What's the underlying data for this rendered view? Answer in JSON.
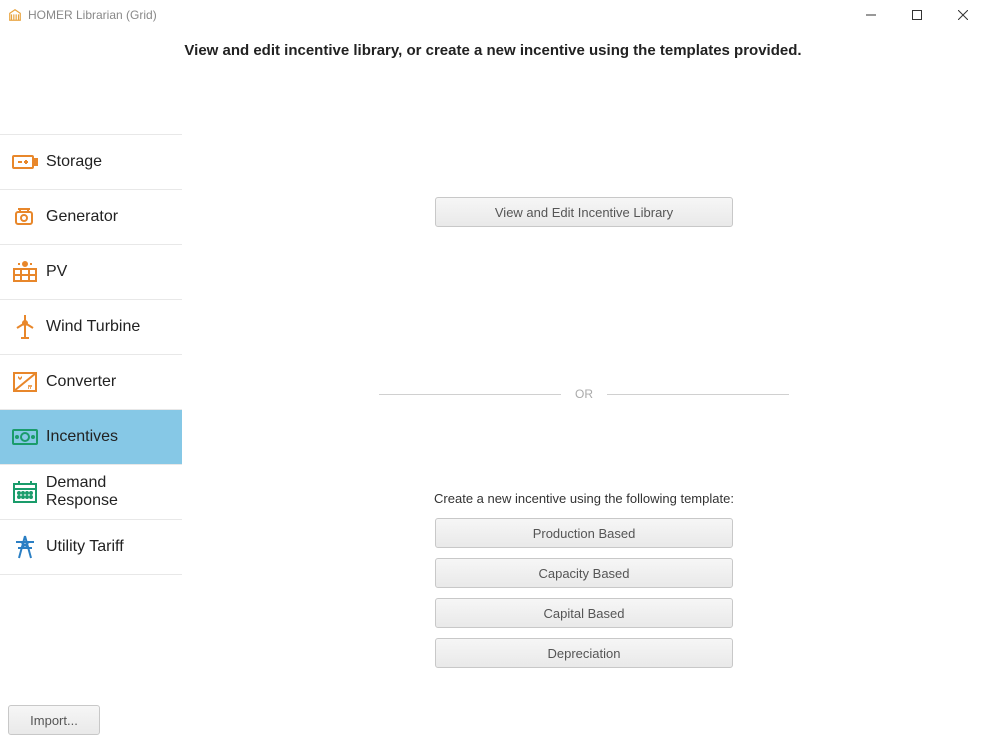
{
  "window": {
    "title": "HOMER Librarian (Grid)"
  },
  "header": {
    "description": "View and edit incentive library, or create a new incentive using the templates provided."
  },
  "sidebar": {
    "items": [
      {
        "label": "Storage"
      },
      {
        "label": "Generator"
      },
      {
        "label": "PV"
      },
      {
        "label": "Wind Turbine"
      },
      {
        "label": "Converter"
      },
      {
        "label": "Incentives"
      },
      {
        "label": "Demand Response"
      },
      {
        "label": "Utility Tariff"
      }
    ],
    "import_label": "Import..."
  },
  "content": {
    "view_edit_label": "View and Edit Incentive Library",
    "or_label": "OR",
    "template_heading": "Create a new incentive using the following template:",
    "templates": [
      {
        "label": "Production Based"
      },
      {
        "label": "Capacity Based"
      },
      {
        "label": "Capital Based"
      },
      {
        "label": "Depreciation"
      }
    ]
  }
}
